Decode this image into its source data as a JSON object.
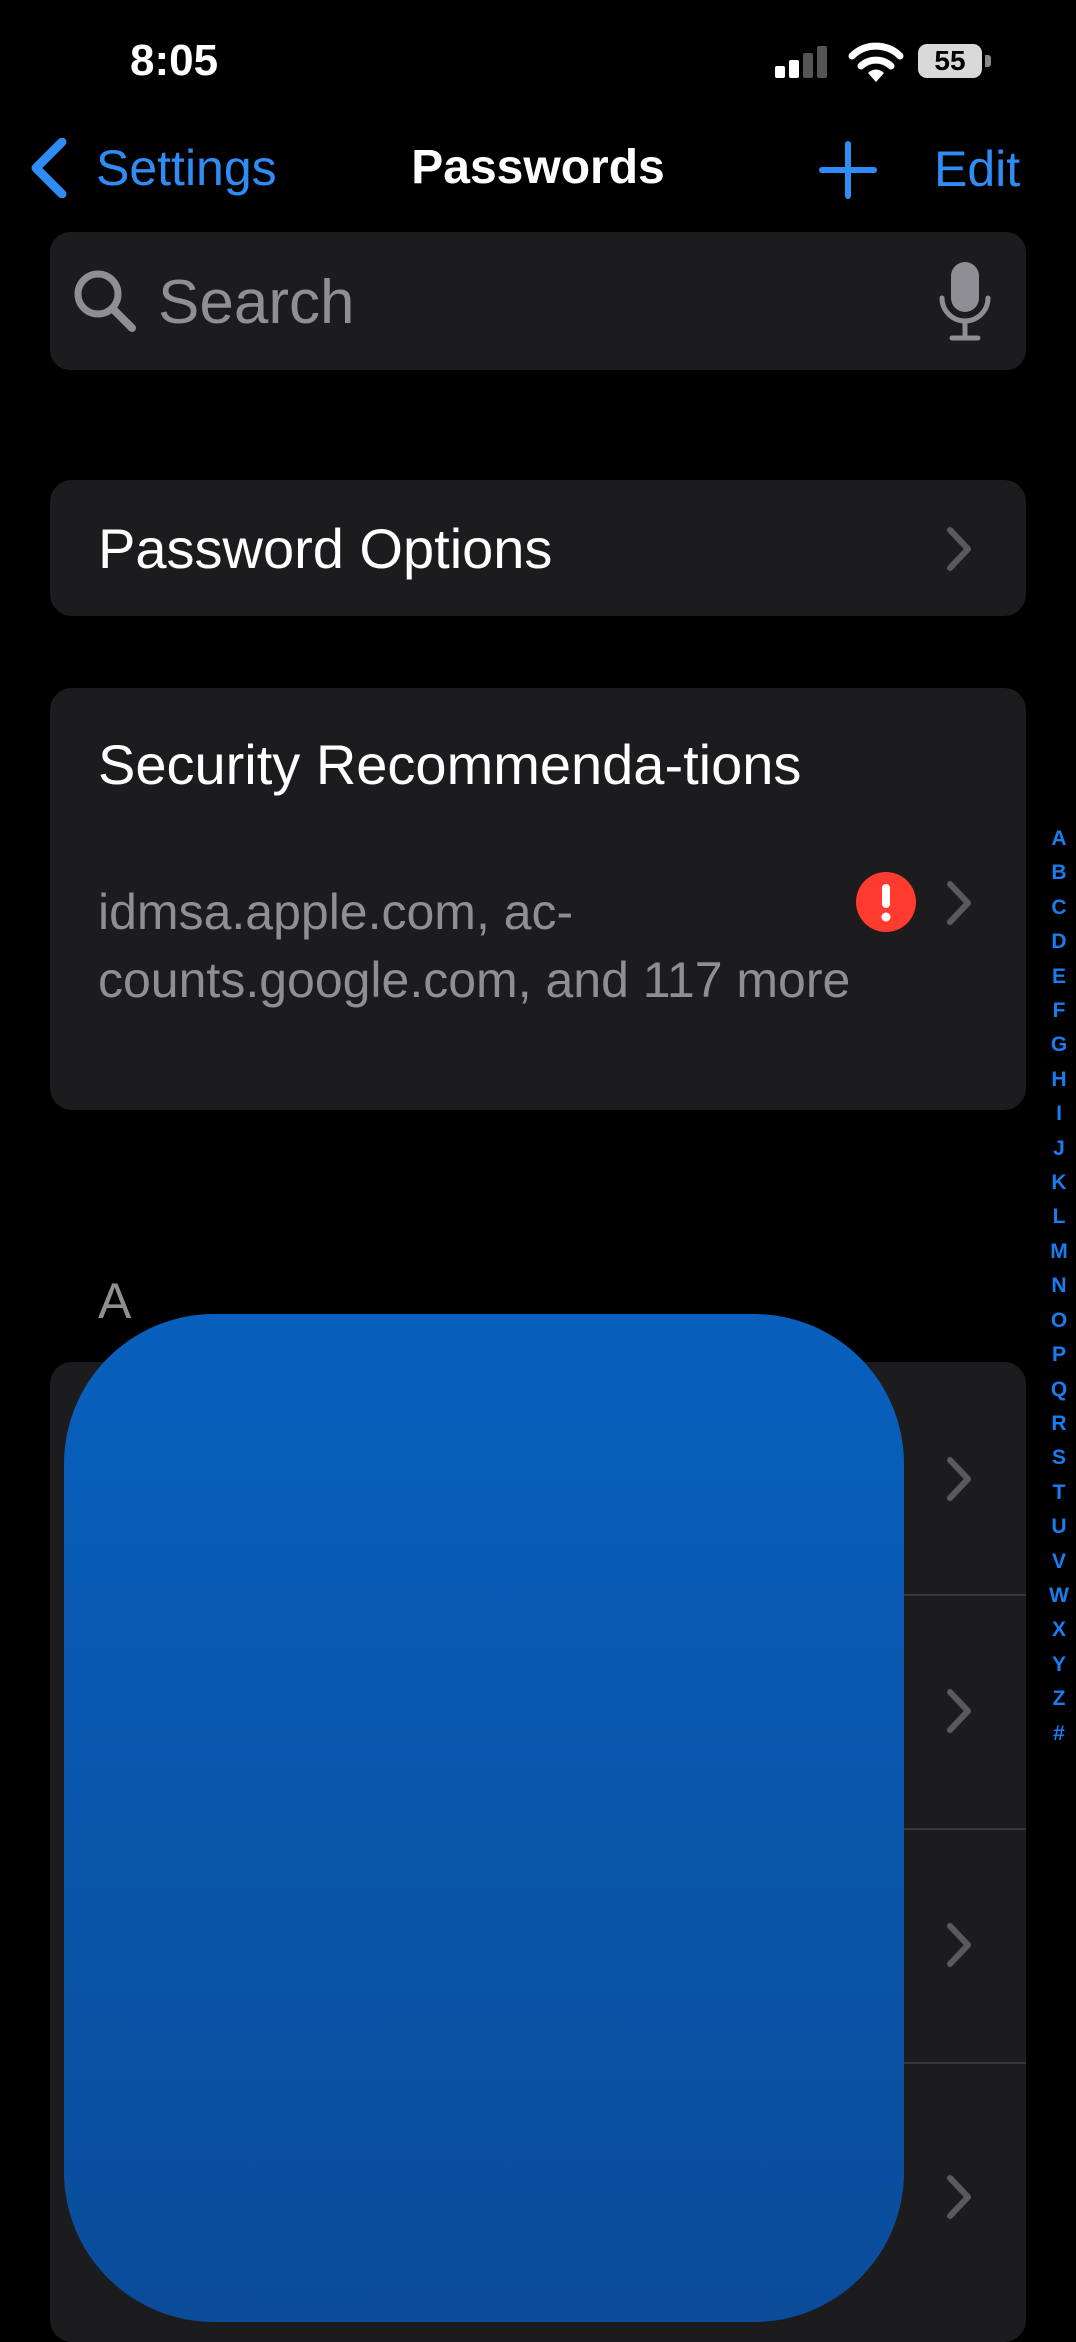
{
  "status_bar": {
    "time": "8:05",
    "battery": "55"
  },
  "nav": {
    "back_label": "Settings",
    "title": "Passwords",
    "edit_label": "Edit"
  },
  "search": {
    "placeholder": "Search"
  },
  "options": {
    "label": "Password Options"
  },
  "security": {
    "title": "Security Recommenda-tions",
    "subtitle": "idmsa.apple.com, ac-counts.google.com, and 117 more"
  },
  "section_a": {
    "header": "A"
  },
  "index": [
    "A",
    "B",
    "C",
    "D",
    "E",
    "F",
    "G",
    "H",
    "I",
    "J",
    "K",
    "L",
    "M",
    "N",
    "O",
    "P",
    "Q",
    "R",
    "S",
    "T",
    "U",
    "V",
    "W",
    "X",
    "Y",
    "Z",
    "#"
  ],
  "colors": {
    "accent": "#2f8cf5",
    "alert": "#ff3b30",
    "cell": "#1c1c1e",
    "overlay": "#0a56ad"
  },
  "icons": [
    "back-chevron-icon",
    "plus-icon",
    "search-icon",
    "microphone-icon",
    "chevron-right-icon",
    "exclamation-icon",
    "cellular-signal-icon",
    "wifi-icon",
    "battery-icon"
  ]
}
